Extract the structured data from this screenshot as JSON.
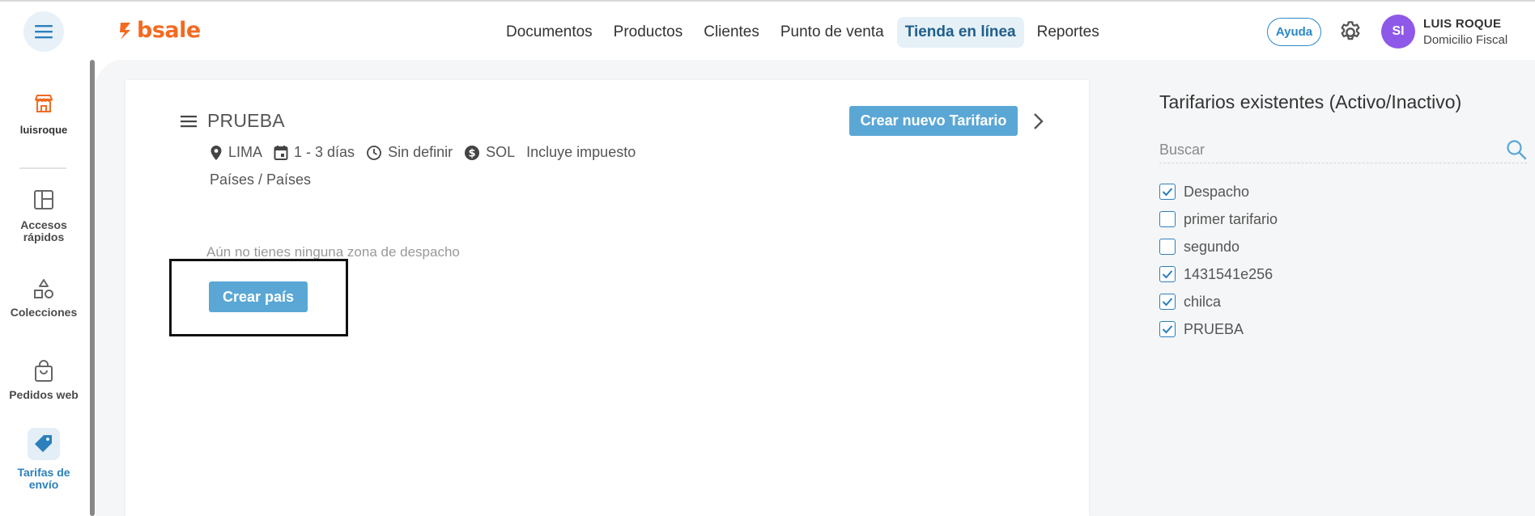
{
  "header": {
    "logo_text": "bsale",
    "nav": [
      "Documentos",
      "Productos",
      "Clientes",
      "Punto de venta",
      "Tienda en línea",
      "Reportes"
    ],
    "active_nav": "Tienda en línea",
    "help_label": "Ayuda",
    "user": {
      "initials": "SI",
      "name": "LUIS ROQUE",
      "subtitle": "Domicilio Fiscal"
    }
  },
  "sidebar": {
    "store_label": "luisroque",
    "items": [
      {
        "label_1": "Accesos",
        "label_2": "rápidos",
        "icon": "layout-icon"
      },
      {
        "label_1": "Colecciones",
        "icon": "shapes-icon"
      },
      {
        "label_1": "Pedidos web",
        "icon": "bag-icon"
      },
      {
        "label_1": "Tarifas de",
        "label_2": "envío",
        "icon": "tag-icon",
        "active": true
      }
    ]
  },
  "tariff": {
    "title": "PRUEBA",
    "new_button": "Crear nuevo Tarifario",
    "location": "LIMA",
    "days": "1 - 3 días",
    "time": "Sin definir",
    "currency": "SOL",
    "tax": "Incluye impuesto",
    "countries": "Países / Países",
    "empty_message": "Aún no tienes ninguna zona de despacho",
    "create_country_button": "Crear país"
  },
  "right_panel": {
    "title": "Tarifarios existentes (Activo/Inactivo)",
    "search_placeholder": "Buscar",
    "tariffs": [
      {
        "name": "Despacho",
        "active": true
      },
      {
        "name": "primer tarifario",
        "active": false
      },
      {
        "name": "segundo",
        "active": false
      },
      {
        "name": "1431541e256",
        "active": true
      },
      {
        "name": "chilca",
        "active": true
      },
      {
        "name": "PRUEBA",
        "active": true
      }
    ]
  },
  "colors": {
    "accent": "#5aa7d6",
    "brand": "#f26b21",
    "avatar": "#8e58e8",
    "active_nav_text": "#1f5f8b"
  }
}
